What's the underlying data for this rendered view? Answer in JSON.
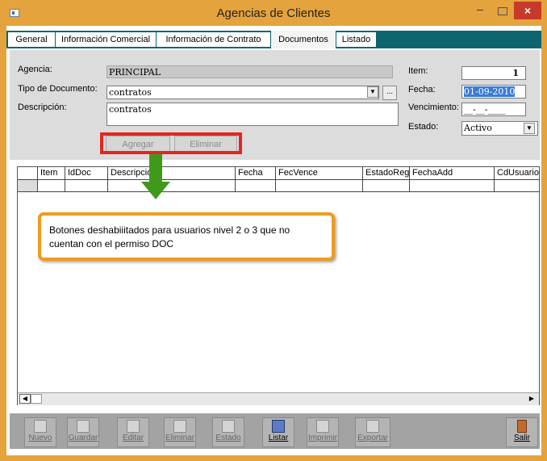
{
  "window": {
    "title": "Agencias de Clientes",
    "minimize": "–",
    "close": "×"
  },
  "tabs": [
    {
      "label": "General",
      "active": false
    },
    {
      "label": "Información Comercial",
      "active": false
    },
    {
      "label": "Información de Contrato",
      "active": false
    },
    {
      "label": "Documentos",
      "active": true
    },
    {
      "label": "Listado",
      "active": false
    }
  ],
  "form": {
    "agencia_label": "Agencia:",
    "agencia_value": "PRINCIPAL",
    "tipo_label": "Tipo de Documento:",
    "tipo_value": "contratos",
    "descripcion_label": "Descripción:",
    "descripcion_value": "contratos",
    "item_label": "Item:",
    "item_value": "1",
    "fecha_label": "Fecha:",
    "fecha_value": "01-09-2010",
    "vencimiento_label": "Vencimiento:",
    "vencimiento_value": "__-__-____",
    "estado_label": "Estado:",
    "estado_value": "Activo",
    "ellipsis": "...",
    "agregar_label": "Agregar",
    "eliminar_label": "Eliminar"
  },
  "grid": {
    "columns": [
      "Item",
      "IdDoc",
      "Descripción",
      "Fecha",
      "FecVence",
      "EstadoReg",
      "FechaAdd",
      "CdUsuario"
    ]
  },
  "callout": {
    "text": "Botones deshabiiitados para usuarios nivel 2 o 3 que no cuentan con el permiso DOC"
  },
  "toolbar": {
    "nuevo": "Nuevo",
    "guardar": "Guardar",
    "editar": "Editar",
    "eliminar": "Eliminar",
    "estado": "Estado",
    "listar": "Listar",
    "imprimir": "Imprimir",
    "exportar": "Exportar",
    "salir": "Salir"
  },
  "colors": {
    "accent_frame": "#e4a33c",
    "tab_bar": "#0d6570",
    "highlight": "#e3261f",
    "arrow": "#3f9a1c",
    "callout_border": "#f09b1e"
  }
}
